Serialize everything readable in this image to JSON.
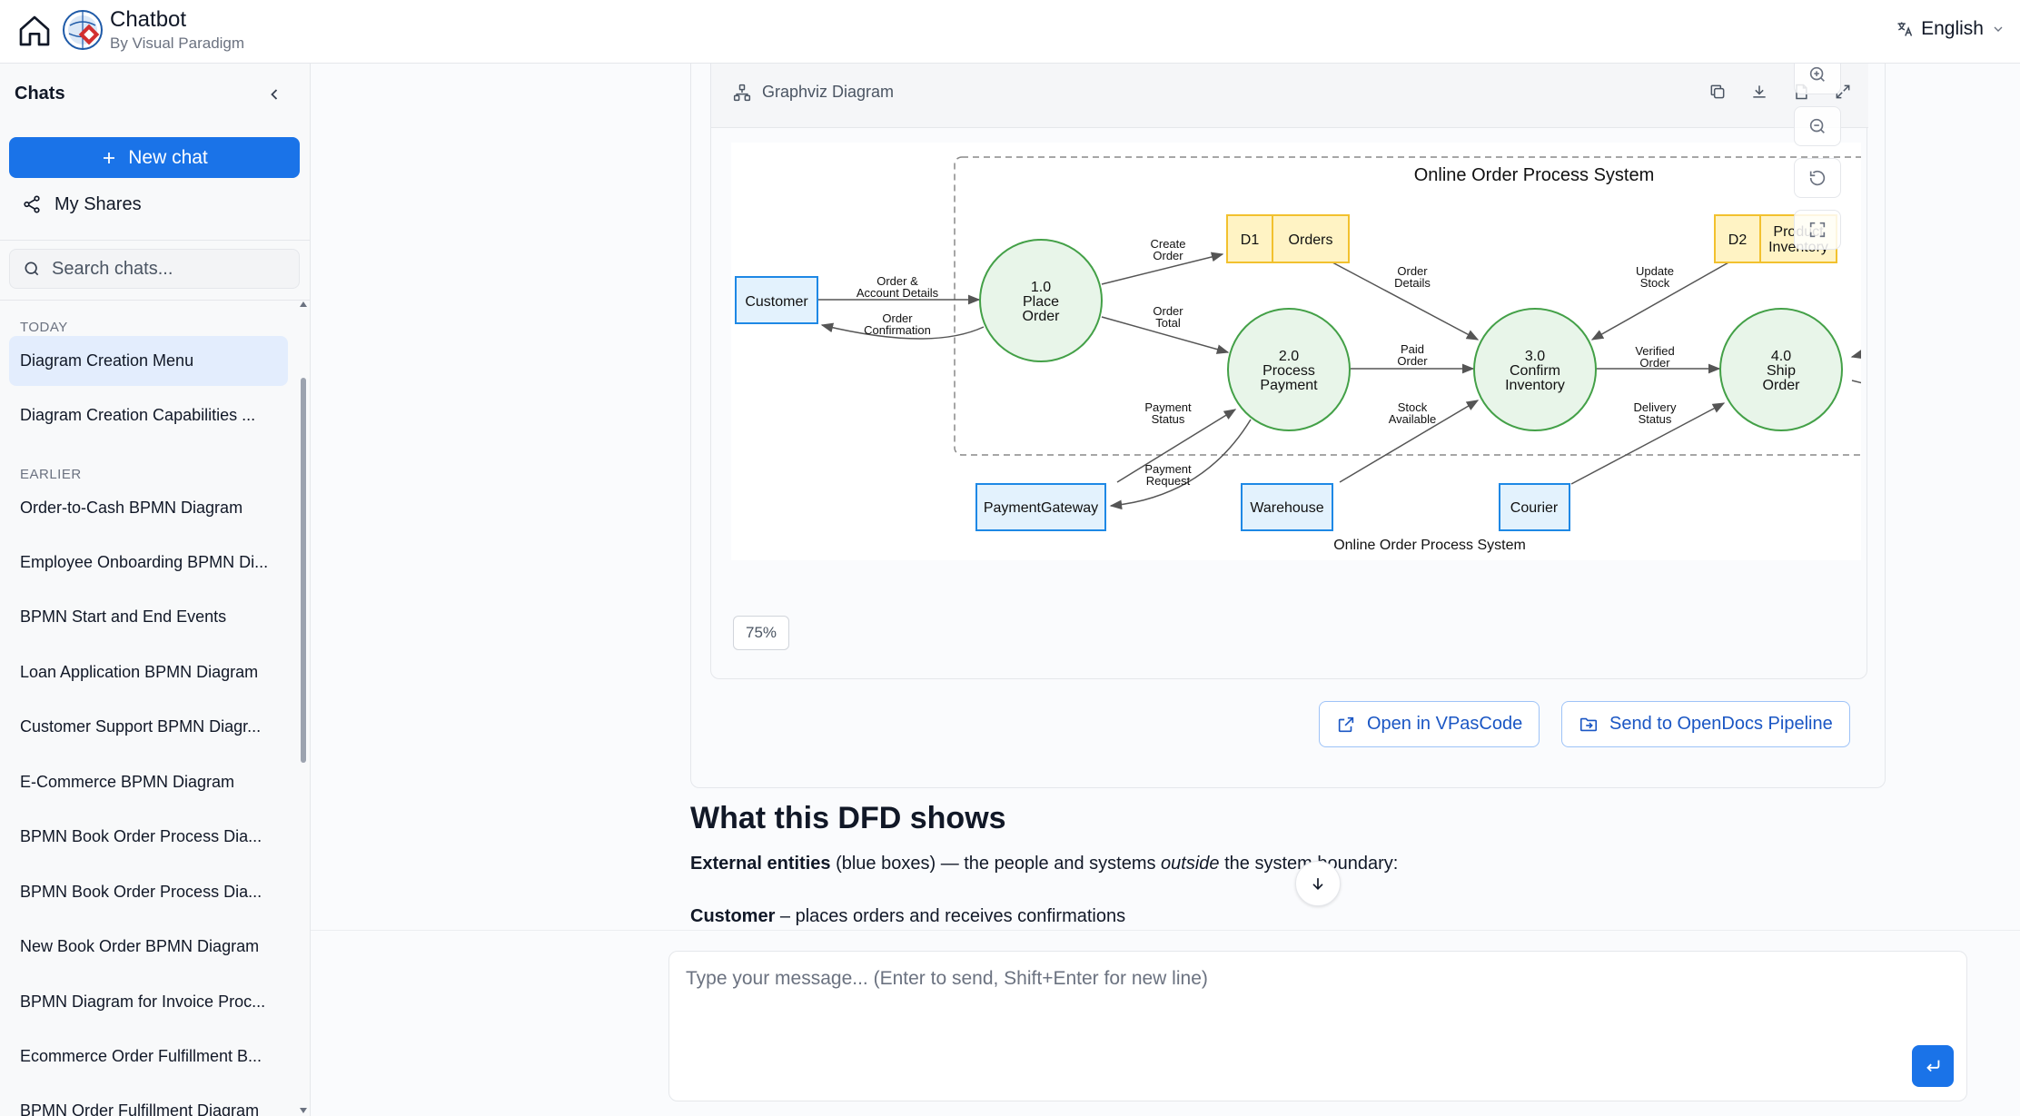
{
  "header": {
    "title": "Chatbot",
    "subtitle": "By Visual Paradigm",
    "language": "English"
  },
  "sidebar": {
    "heading": "Chats",
    "new_chat": "New chat",
    "my_shares": "My Shares",
    "search_placeholder": "Search chats...",
    "sections": [
      {
        "label": "TODAY",
        "items": [
          "Diagram Creation Menu",
          "Diagram Creation Capabilities ..."
        ]
      },
      {
        "label": "EARLIER",
        "items": [
          "Order-to-Cash BPMN Diagram",
          "Employee Onboarding BPMN Di...",
          "BPMN Start and End Events",
          "Loan Application BPMN Diagram",
          "Customer Support BPMN Diagr...",
          "E-Commerce BPMN Diagram",
          "BPMN Book Order Process Dia...",
          "BPMN Book Order Process Dia...",
          "New Book Order BPMN Diagram",
          "BPMN Diagram for Invoice Proc...",
          "Ecommerce Order Fulfillment B...",
          "BPMN Order Fulfillment Diagram"
        ]
      }
    ]
  },
  "diagram_panel": {
    "title": "Graphviz Diagram",
    "zoom": "75%",
    "open_button": "Open in VPasCode",
    "send_button": "Send to OpenDocs Pipeline"
  },
  "diagram": {
    "cluster_label": "Online Order Process System",
    "graph_label": "Online Order Process System",
    "entities": {
      "customer": "Customer",
      "payment_gateway": "PaymentGateway",
      "warehouse": "Warehouse",
      "courier": "Courier"
    },
    "processes": {
      "p1": [
        "1.0",
        "Place",
        "Order"
      ],
      "p2": [
        "2.0",
        "Process",
        "Payment"
      ],
      "p3": [
        "3.0",
        "Confirm",
        "Inventory"
      ],
      "p4": [
        "4.0",
        "Ship",
        "Order"
      ]
    },
    "stores": {
      "d1_id": "D1",
      "d1_name": "Orders",
      "d2_id": "D2",
      "d2_name_1": "Product",
      "d2_name_2": "Inventory"
    },
    "flows": {
      "f1": [
        "Order &",
        "Account Details"
      ],
      "f2": [
        "Order",
        "Confirmation"
      ],
      "f3": [
        "Create",
        "Order"
      ],
      "f4": [
        "Order",
        "Total"
      ],
      "f5": [
        "Order",
        "Details"
      ],
      "f6": [
        "Paid",
        "Order"
      ],
      "f7": [
        "Payment",
        "Status"
      ],
      "f8": [
        "Payment",
        "Request"
      ],
      "f9": [
        "Stock",
        "Available"
      ],
      "f10": [
        "Update",
        "Stock"
      ],
      "f11": [
        "Verified",
        "Order"
      ],
      "f12": [
        "Delivery",
        "Status"
      ]
    }
  },
  "content": {
    "heading": "What this DFD shows",
    "p1_bold": "External entities",
    "p1_a": " (blue boxes) — the people and systems ",
    "p1_em": "outside",
    "p1_b": " the system boundary:",
    "p2_bold": "Customer",
    "p2_rest": " – places orders and receives confirmations"
  },
  "composer": {
    "placeholder": "Type your message... (Enter to send, Shift+Enter for new line)"
  },
  "colors": {
    "primary": "#1a73e8",
    "entity_fill": "#e3f2fd",
    "entity_stroke": "#1e88e5",
    "process_fill": "#e8f5e9",
    "process_stroke": "#43a047",
    "store_fill": "#fff3c4",
    "store_stroke": "#f2c12e"
  }
}
